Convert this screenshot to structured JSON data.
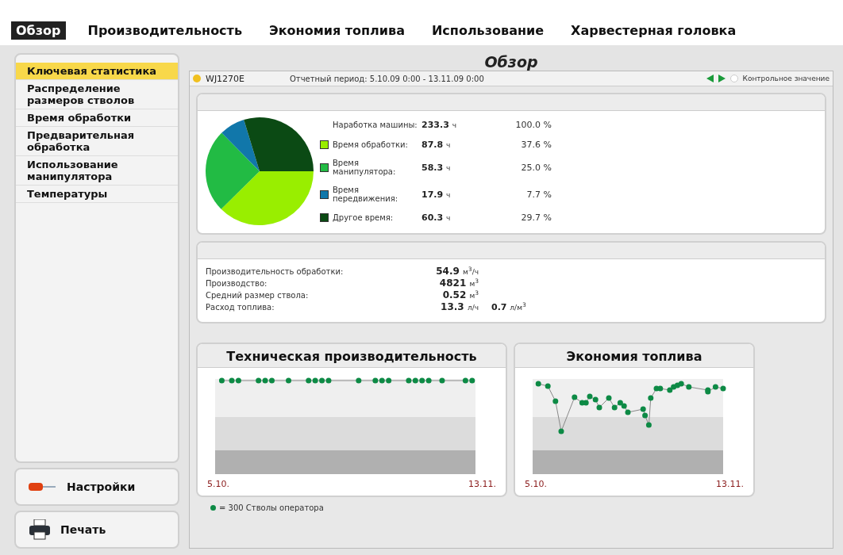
{
  "tabs": [
    {
      "label": "Обзор",
      "selected": true
    },
    {
      "label": "Производительность",
      "selected": false
    },
    {
      "label": "Экономия топлива",
      "selected": false
    },
    {
      "label": "Использование",
      "selected": false
    },
    {
      "label": "Харвестерная головка",
      "selected": false
    }
  ],
  "sidebar": {
    "items": [
      {
        "label": "Ключевая статистика",
        "selected": true
      },
      {
        "label": "Распределение размеров стволов",
        "selected": false
      },
      {
        "label": "Время обработки",
        "selected": false
      },
      {
        "label": "Предварительная обработка",
        "selected": false
      },
      {
        "label": "Использование манипулятора",
        "selected": false
      },
      {
        "label": "Температуры",
        "selected": false
      }
    ],
    "buttons": [
      {
        "kind": "settings",
        "label": "Настройки"
      },
      {
        "kind": "print",
        "label": "Печать"
      }
    ]
  },
  "page_title": "Обзор",
  "header": {
    "machine": "WJ1270E",
    "period": "Отчетный период: 5.10.09 0:00 - 13.11.09 0:00",
    "reference": {
      "label": "Контрольное значение",
      "selected": false
    }
  },
  "time_card": {
    "total": {
      "label": "Наработка машины:",
      "value": "233.3",
      "unit": "ч",
      "percent": "100.0 %"
    },
    "rows": [
      {
        "label": "Время обработки:",
        "value": "87.8",
        "unit": "ч",
        "percent": "37.6 %",
        "color": "#99ee00"
      },
      {
        "label": "Время манипулятора:",
        "value": "58.3",
        "unit": "ч",
        "percent": "25.0 %",
        "color": "#22bb44"
      },
      {
        "label": "Время передвижения:",
        "value": "17.9",
        "unit": "ч",
        "percent": "7.7 %",
        "color": "#1177aa"
      },
      {
        "label": "Другое время:",
        "value": "60.3",
        "unit": "ч",
        "percent": "29.7 %",
        "color": "#0b4a14"
      }
    ],
    "chart_data": {
      "type": "pie",
      "values": [
        37.6,
        25.0,
        7.7,
        29.7
      ]
    }
  },
  "metrics": [
    {
      "label": "Производительность обработки:",
      "value": "54.9",
      "unit": "м$^{3}$/ч"
    },
    {
      "label": "Производство:",
      "value": "4821",
      "unit": "м$^{3}$"
    },
    {
      "label": "Средний размер ствола:",
      "value": "0.52",
      "unit": "м$^{3}$"
    },
    {
      "label": "Расход топлива:",
      "value": "13.3",
      "unit": "л/ч",
      "extra_value": "0.7",
      "extra_unit": "л/м$^{3}$"
    }
  ],
  "charts": [
    {
      "kind": "flat",
      "title": "Техническая производительность",
      "x_start": "5.10.",
      "x_end": "13.11."
    },
    {
      "kind": "wavy",
      "title": "Экономия топлива",
      "x_start": "5.10.",
      "x_end": "13.11."
    }
  ],
  "legend": "= 300 Стволы оператора"
}
